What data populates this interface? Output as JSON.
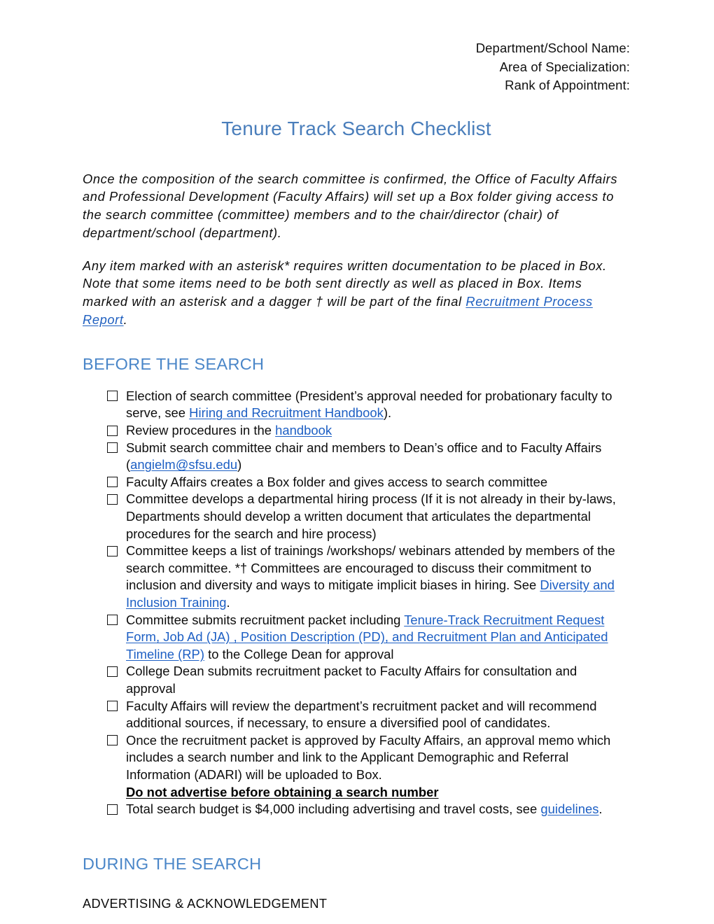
{
  "header": {
    "lines": [
      "Department/School Name:",
      "Area of Specialization:",
      "Rank of Appointment:"
    ]
  },
  "title": "Tenure Track Search Checklist",
  "intro": {
    "paragraph_1": "Once the composition of the search committee is confirmed, the Office of Faculty Affairs and Professional Development (Faculty Affairs) will set up a Box folder giving access to the search committee (committee) members and to the chair/director (chair) of department/school (department).",
    "paragraph_2_before_link": "Any item marked with an asterisk* requires written documentation to be placed in Box. Note that some items need to be both sent directly as well as placed in Box. Items marked with an asterisk and a dagger † will be part of the final ",
    "paragraph_2_link": "Recruitment Process Report",
    "paragraph_2_after_link": "."
  },
  "sections": {
    "before_the_search": {
      "heading": "BEFORE THE SEARCH",
      "items": [
        {
          "parts": [
            {
              "type": "text",
              "value": "Election of search committee (President’s approval needed for probationary faculty to serve, see "
            },
            {
              "type": "link",
              "value": "Hiring and Recruitment Handbook"
            },
            {
              "type": "text",
              "value": ")."
            }
          ]
        },
        {
          "parts": [
            {
              "type": "text",
              "value": "Review procedures in the "
            },
            {
              "type": "link",
              "value": "handbook"
            }
          ]
        },
        {
          "parts": [
            {
              "type": "text",
              "value": "Submit search committee chair and members to Dean’s office and to Faculty Affairs ("
            },
            {
              "type": "link",
              "value": "angielm@sfsu.edu"
            },
            {
              "type": "text",
              "value": ")"
            }
          ]
        },
        {
          "parts": [
            {
              "type": "text",
              "value": "Faculty Affairs creates a Box folder and gives access to search committee"
            }
          ]
        },
        {
          "parts": [
            {
              "type": "text",
              "value": "Committee develops a departmental hiring process (If it is not already in their by-laws, Departments should develop a written document that articulates the departmental procedures for the search and hire process)"
            }
          ]
        },
        {
          "parts": [
            {
              "type": "text",
              "value": "Committee keeps a list of trainings /workshops/ webinars attended by members of the search committee. *† Committees are encouraged to discuss their commitment to inclusion and diversity and ways to mitigate implicit biases in hiring. See "
            },
            {
              "type": "link",
              "value": "Diversity and Inclusion Training"
            },
            {
              "type": "text",
              "value": "."
            }
          ]
        },
        {
          "parts": [
            {
              "type": "text",
              "value": "Committee submits recruitment packet including "
            },
            {
              "type": "link",
              "value": "Tenure-Track Recruitment Request Form, Job Ad (JA) , Position Description (PD), and Recruitment Plan and Anticipated Timeline (RP)"
            },
            {
              "type": "text",
              "value": " to the College Dean for approval"
            }
          ]
        },
        {
          "parts": [
            {
              "type": "text",
              "value": "College Dean submits recruitment packet to Faculty Affairs for consultation and approval"
            }
          ]
        },
        {
          "parts": [
            {
              "type": "text",
              "value": "Faculty Affairs will review the department’s recruitment packet and will recommend additional sources, if necessary, to ensure a diversified pool of candidates."
            }
          ]
        },
        {
          "parts": [
            {
              "type": "text",
              "value": "Once the recruitment packet is approved by Faculty Affairs, an approval memo which includes a search number and link to the Applicant Demographic and Referral Information (ADARI) will be uploaded to Box."
            },
            {
              "type": "bold-underline-block",
              "value": "Do not advertise before obtaining a search number"
            }
          ]
        },
        {
          "parts": [
            {
              "type": "text",
              "value": "Total search budget is $4,000 including advertising and travel costs, see "
            },
            {
              "type": "link",
              "value": "guidelines"
            },
            {
              "type": "text",
              "value": "."
            }
          ]
        }
      ]
    },
    "during_the_search": {
      "heading": "DURING THE SEARCH",
      "sub_heading": "ADVERTISING & ACKNOWLEDGEMENT"
    }
  },
  "colors": {
    "heading_blue": "#4a86c8",
    "title_blue": "#4a7ebb",
    "link_blue": "#1d5fc4",
    "body_text": "#0d0d0d",
    "page_background": "#ffffff"
  }
}
